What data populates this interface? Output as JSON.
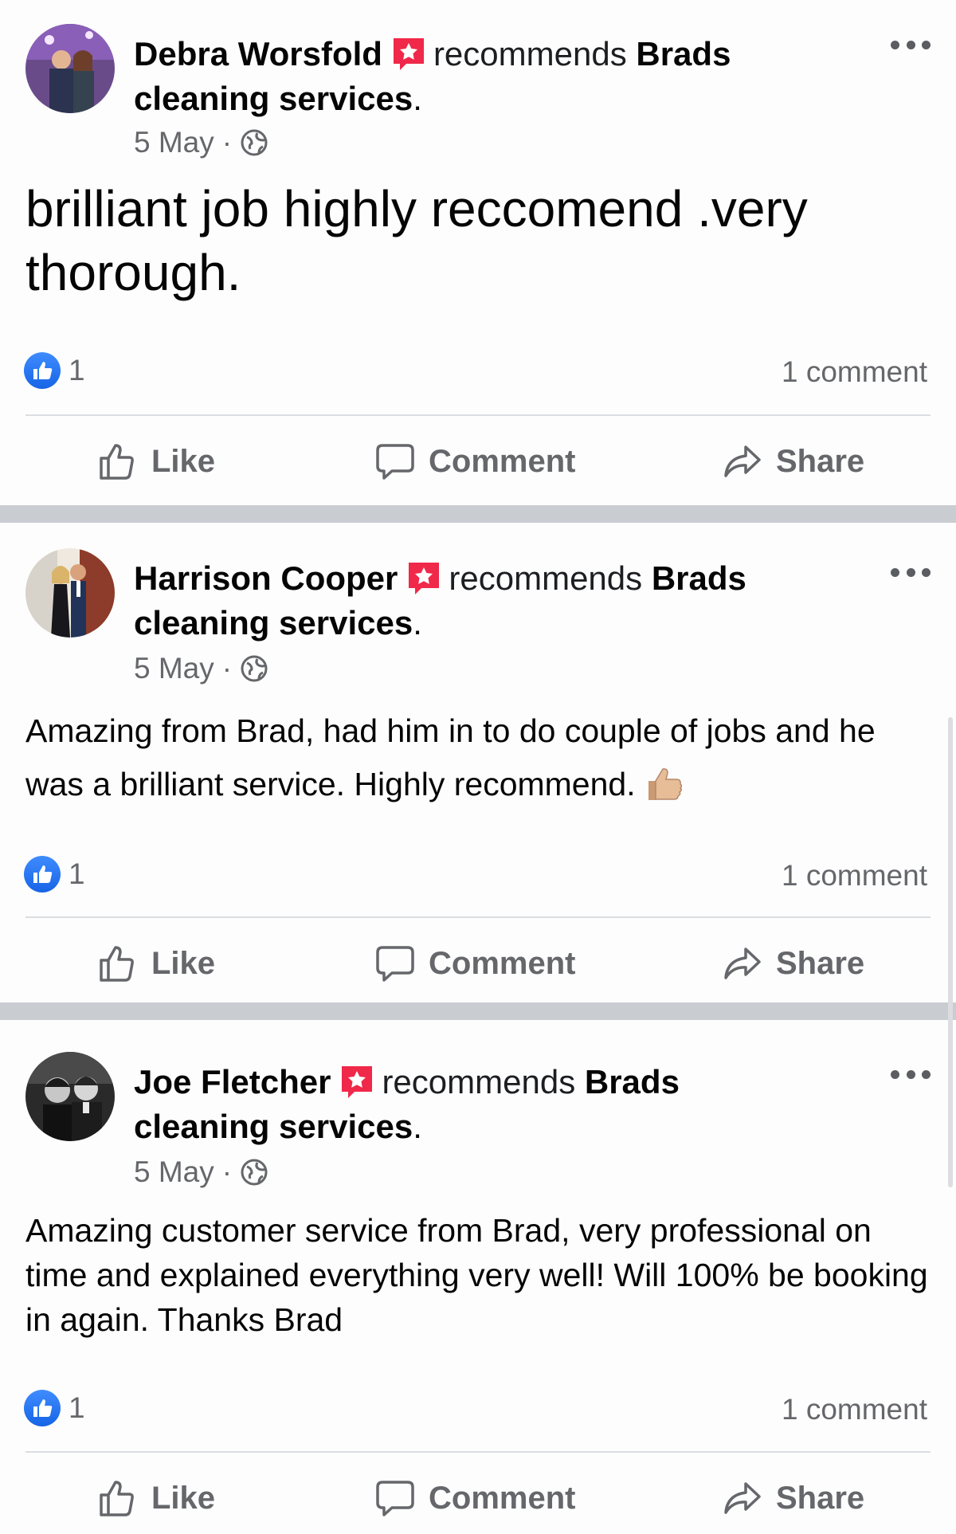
{
  "posts": [
    {
      "author": "Debra Worsfold",
      "recommends_text": "recommends",
      "page_name": "Brads cleaning services",
      "page_suffix": ".",
      "date": "5 May",
      "separator_dot": "·",
      "body": "brilliant job highly reccomend .very thorough.",
      "likes": "1",
      "comments": "1 comment",
      "actions": {
        "like": "Like",
        "comment": "Comment",
        "share": "Share"
      }
    },
    {
      "author": "Harrison Cooper",
      "recommends_text": "recommends",
      "page_name": "Brads cleaning services",
      "page_suffix": ".",
      "date": "5 May",
      "separator_dot": "·",
      "body": "Amazing from Brad, had him in to do couple of jobs and he was a brilliant service. Highly recommend.",
      "body_emoji": "thumbs-up-emoji",
      "likes": "1",
      "comments": "1 comment",
      "actions": {
        "like": "Like",
        "comment": "Comment",
        "share": "Share"
      }
    },
    {
      "author": "Joe Fletcher",
      "recommends_text": "recommends",
      "page_name": "Brads cleaning services",
      "page_suffix": ".",
      "date": "5 May",
      "separator_dot": "·",
      "body": "Amazing customer service from Brad, very professional on time and explained everything very well! Will 100% be booking in again. Thanks Brad",
      "likes": "1",
      "comments": "1 comment",
      "actions": {
        "like": "Like",
        "comment": "Comment",
        "share": "Share"
      }
    }
  ],
  "colors": {
    "accent_blue": "#1877f2",
    "recommend_badge": "#f02849",
    "secondary_text": "#65676b",
    "separator": "#c9ccd1"
  },
  "icons": [
    "recommend-star-icon",
    "globe-icon",
    "more-options-icon",
    "like-reaction-icon",
    "like-icon",
    "comment-icon",
    "share-icon"
  ]
}
